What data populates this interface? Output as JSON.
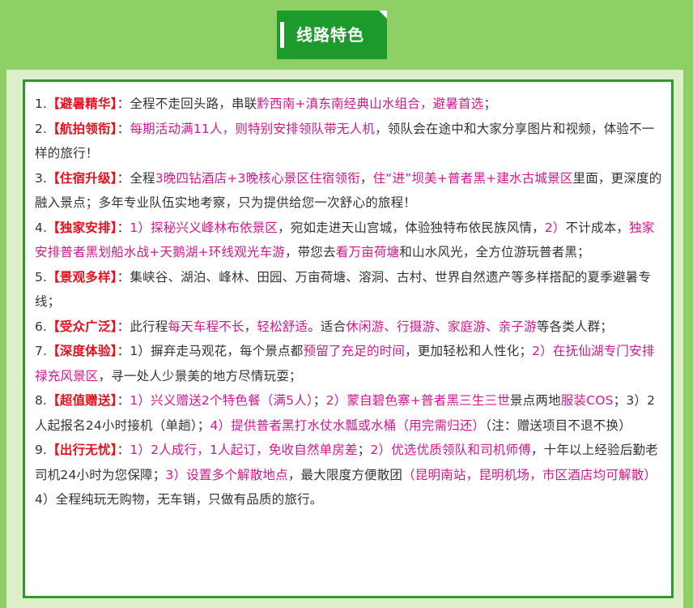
{
  "header": {
    "title": "线路特色"
  },
  "items": [
    {
      "segments": [
        {
          "t": "n",
          "s": "1."
        },
        {
          "t": "h",
          "s": "【避暑精华】"
        },
        {
          "t": "n",
          "s": "：全程不走回头路，串联"
        },
        {
          "t": "p",
          "s": "黔西南+滇东南经典山水组合，避暑首选"
        },
        {
          "t": "n",
          "s": "；"
        }
      ]
    },
    {
      "segments": [
        {
          "t": "n",
          "s": "2."
        },
        {
          "t": "h",
          "s": "【航拍领衔】"
        },
        {
          "t": "n",
          "s": "："
        },
        {
          "t": "p",
          "s": "每期活动满11人，则特别安排领队带无人机"
        },
        {
          "t": "n",
          "s": "，领队会在途中和大家分享图片和视频，体验不一样的旅行！"
        }
      ]
    },
    {
      "segments": [
        {
          "t": "n",
          "s": "3."
        },
        {
          "t": "h",
          "s": "【住宿升级】"
        },
        {
          "t": "n",
          "s": "：全程"
        },
        {
          "t": "p",
          "s": "3晚四钻酒店+3晚核心景区住宿领衔"
        },
        {
          "t": "n",
          "s": "，"
        },
        {
          "t": "p",
          "s": "住“进”坝美+普者黑+建水古城景区"
        },
        {
          "t": "n",
          "s": "里面，更深度的融入景点；多年专业队伍实地考察，只为提供给您一次舒心的旅程！"
        }
      ]
    },
    {
      "segments": [
        {
          "t": "n",
          "s": "4."
        },
        {
          "t": "h",
          "s": "【独家安排】"
        },
        {
          "t": "n",
          "s": "："
        },
        {
          "t": "p",
          "s": "1）探秘兴义峰林布依景区"
        },
        {
          "t": "n",
          "s": "，宛如走进天山宫城，体验独特布依民族风情，"
        },
        {
          "t": "p",
          "s": "2）"
        },
        {
          "t": "n",
          "s": "不计成本，"
        },
        {
          "t": "p",
          "s": "独家安排普者黑划船水战+天鹅湖+环线观光车游"
        },
        {
          "t": "n",
          "s": "，带您去"
        },
        {
          "t": "p",
          "s": "看万亩荷塘"
        },
        {
          "t": "n",
          "s": "和山水风光，全方位游玩普者黑；"
        }
      ]
    },
    {
      "segments": [
        {
          "t": "n",
          "s": "5."
        },
        {
          "t": "h",
          "s": "【景观多样】"
        },
        {
          "t": "n",
          "s": "：集峡谷、湖泊、峰林、田园、万亩荷塘、溶洞、古村、世界自然遗产等多样搭配的夏季避暑专线；"
        }
      ]
    },
    {
      "segments": [
        {
          "t": "n",
          "s": "6."
        },
        {
          "t": "h",
          "s": "【受众广泛】"
        },
        {
          "t": "n",
          "s": "：此行程"
        },
        {
          "t": "p",
          "s": "每天车程不长"
        },
        {
          "t": "n",
          "s": "，"
        },
        {
          "t": "p",
          "s": "轻松舒适"
        },
        {
          "t": "n",
          "s": "。适合"
        },
        {
          "t": "p",
          "s": "休闲游、行摄游、家庭游、亲子游"
        },
        {
          "t": "n",
          "s": "等各类人群；"
        }
      ]
    },
    {
      "segments": [
        {
          "t": "n",
          "s": "7."
        },
        {
          "t": "h",
          "s": "【深度体验】"
        },
        {
          "t": "n",
          "s": "：1）摒弃走马观花，每个景点都"
        },
        {
          "t": "p",
          "s": "预留了充足的时间"
        },
        {
          "t": "n",
          "s": "，更加轻松和人性化；"
        },
        {
          "t": "p",
          "s": "2）在抚仙湖专门安排禄充风景区"
        },
        {
          "t": "n",
          "s": "，寻一处人少景美的地方尽情玩耍；"
        }
      ]
    },
    {
      "segments": [
        {
          "t": "n",
          "s": "8."
        },
        {
          "t": "h",
          "s": "【超值赠送】"
        },
        {
          "t": "n",
          "s": "："
        },
        {
          "t": "p",
          "s": "1）兴义赠送2个特色餐（满5人）"
        },
        {
          "t": "n",
          "s": "；"
        },
        {
          "t": "p",
          "s": "2）蒙自碧色寨+普者黑三生三世"
        },
        {
          "t": "n",
          "s": "景点两地"
        },
        {
          "t": "p",
          "s": "服装COS"
        },
        {
          "t": "n",
          "s": "；3）2人起报名24小时接机（单趟）；"
        },
        {
          "t": "p",
          "s": "4）提供普者黑打水仗水瓢或水桶（用完需归还）"
        },
        {
          "t": "n",
          "s": "（注：赠送项目不退不换）"
        }
      ]
    },
    {
      "segments": [
        {
          "t": "n",
          "s": "9."
        },
        {
          "t": "h",
          "s": "【出行无忧】"
        },
        {
          "t": "n",
          "s": "："
        },
        {
          "t": "p",
          "s": "1）2人成行，1人起订，免收自然单房差"
        },
        {
          "t": "n",
          "s": "；"
        },
        {
          "t": "p",
          "s": "2）优选优质领队和司机师傅"
        },
        {
          "t": "n",
          "s": "，十年以上经验后勤老司机24小时为您保障；"
        },
        {
          "t": "p",
          "s": "3）设置多个解散地点"
        },
        {
          "t": "n",
          "s": "，最大限度方便散团"
        },
        {
          "t": "p",
          "s": "（昆明南站，昆明机场，市区酒店均可解散）"
        },
        {
          "t": "n",
          "s": "4）全程纯玩无购物，无车销，只做有品质的旅行。"
        }
      ]
    }
  ]
}
